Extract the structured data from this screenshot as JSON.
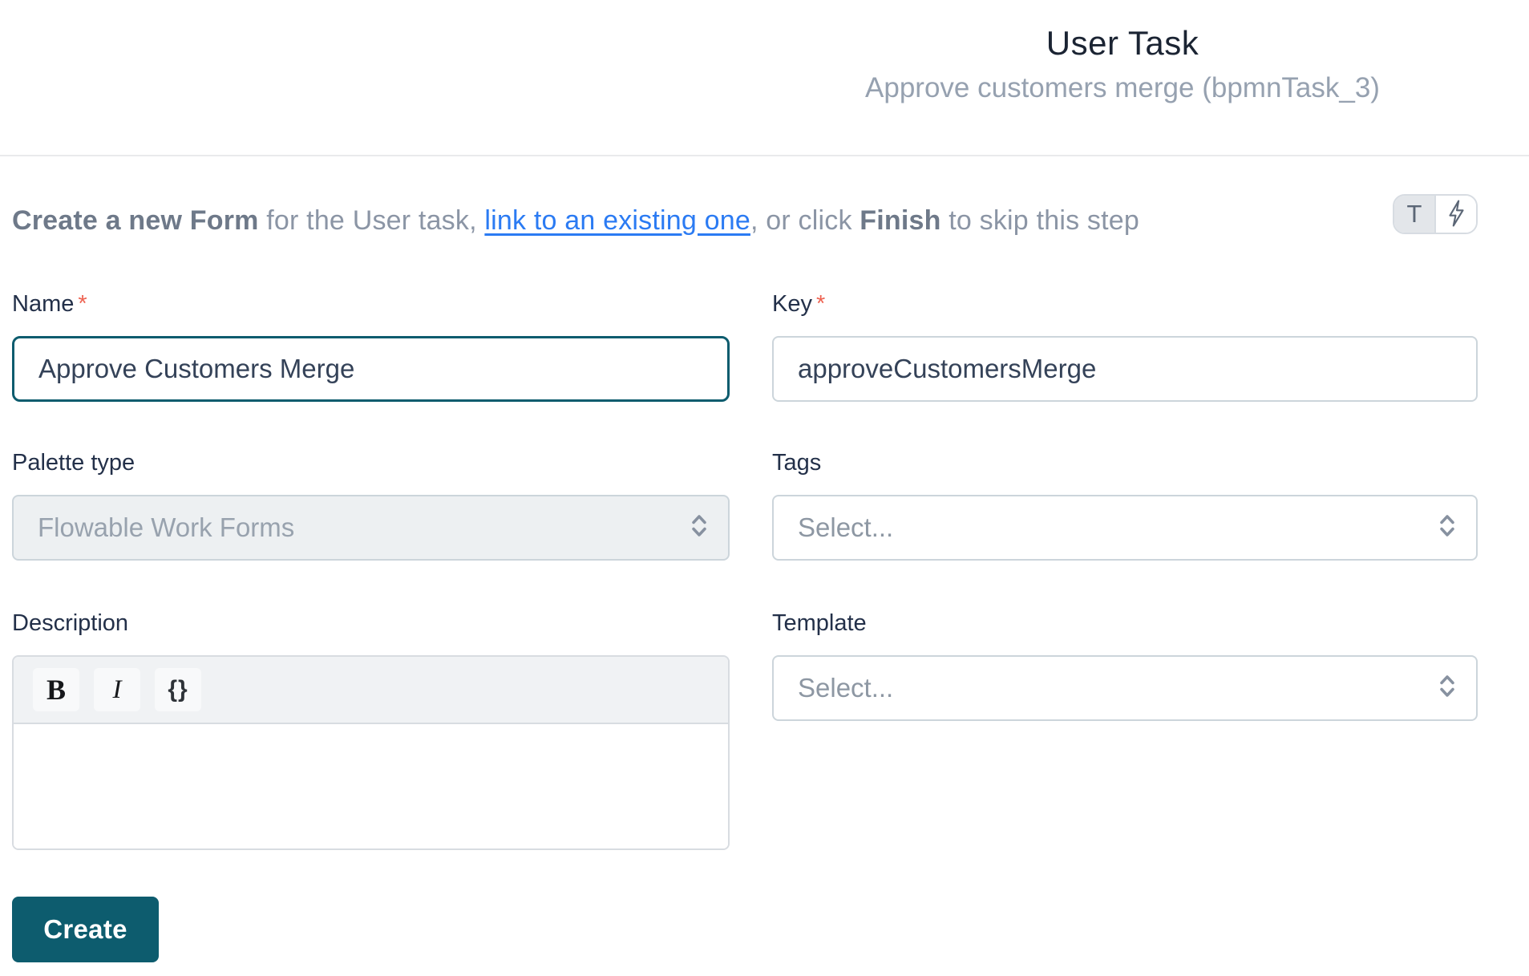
{
  "header": {
    "title": "User Task",
    "subtitle": "Approve customers merge (bpmnTask_3)"
  },
  "intro": {
    "bold1": "Create a new Form",
    "text1": " for the User task, ",
    "link": "link to an existing one",
    "text2": ", or click ",
    "bold2": "Finish",
    "text3": " to skip this step"
  },
  "toggle": {
    "text_label": "T",
    "icons": [
      "text-mode-icon",
      "lightning-bolt-icon"
    ]
  },
  "form": {
    "name": {
      "label": "Name",
      "required": "*",
      "value": "Approve Customers Merge"
    },
    "key": {
      "label": "Key",
      "required": "*",
      "value": "approveCustomersMerge"
    },
    "palette": {
      "label": "Palette type",
      "value": "Flowable Work Forms",
      "disabled": true,
      "icon": "chevron-updown-icon"
    },
    "tags": {
      "label": "Tags",
      "placeholder": "Select...",
      "icon": "chevron-updown-icon"
    },
    "description": {
      "label": "Description",
      "toolbar": {
        "bold": "B",
        "italic": "I",
        "braces": "{}"
      },
      "value": ""
    },
    "template": {
      "label": "Template",
      "placeholder": "Select...",
      "icon": "chevron-updown-icon"
    }
  },
  "actions": {
    "create": "Create"
  },
  "colors": {
    "accent": "#0d5c6e",
    "link": "#2b7bf3",
    "danger": "#ee6352",
    "label": "#233049",
    "muted_text": "#8b95a5"
  }
}
